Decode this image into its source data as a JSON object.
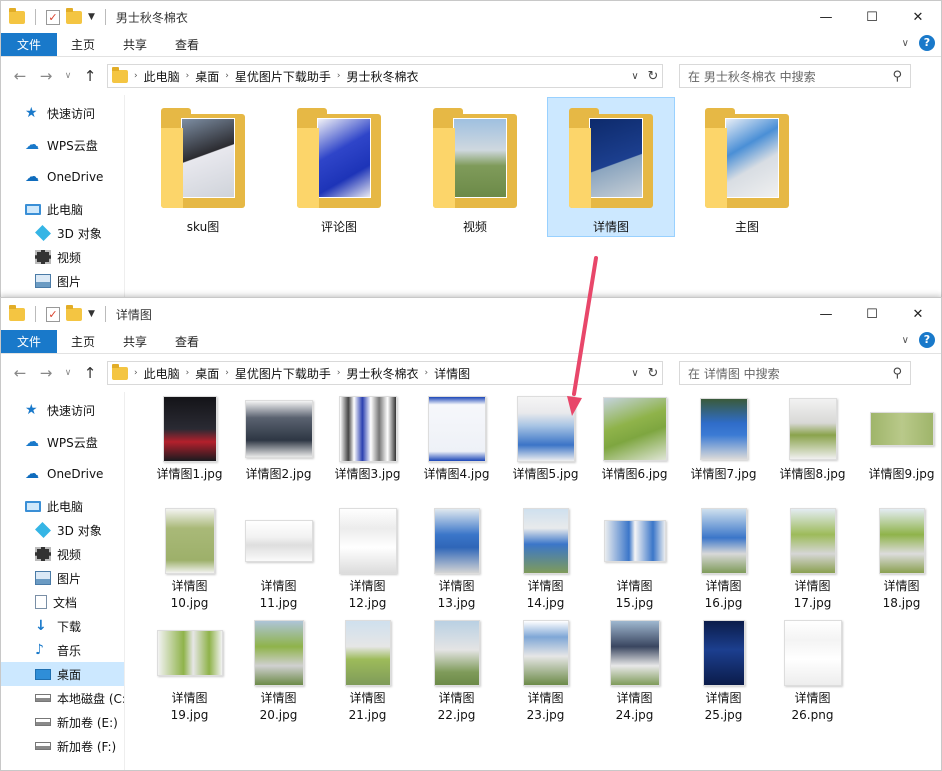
{
  "window1": {
    "title": "男士秋冬棉衣",
    "ribbon_tabs": [
      "文件",
      "主页",
      "共享",
      "查看"
    ],
    "breadcrumb": [
      "此电脑",
      "桌面",
      "星优图片下载助手",
      "男士秋冬棉衣"
    ],
    "search_placeholder": "在 男士秋冬棉衣 中搜索",
    "nav": [
      "快速访问",
      "WPS云盘",
      "OneDrive",
      "此电脑",
      "3D 对象",
      "视频",
      "图片"
    ],
    "folders": [
      "sku图",
      "评论图",
      "视频",
      "详情图",
      "主图"
    ],
    "selected_folder": "详情图"
  },
  "window2": {
    "title": "详情图",
    "ribbon_tabs": [
      "文件",
      "主页",
      "共享",
      "查看"
    ],
    "breadcrumb": [
      "此电脑",
      "桌面",
      "星优图片下载助手",
      "男士秋冬棉衣",
      "详情图"
    ],
    "search_placeholder": "在 详情图 中搜索",
    "nav": [
      "快速访问",
      "WPS云盘",
      "OneDrive",
      "此电脑",
      "3D 对象",
      "视频",
      "图片",
      "文档",
      "下载",
      "音乐",
      "桌面",
      "本地磁盘 (C:",
      "新加卷 (E:)",
      "新加卷 (F:)"
    ],
    "selected_nav": "桌面",
    "files": [
      "详情图1.jpg",
      "详情图2.jpg",
      "详情图3.jpg",
      "详情图4.jpg",
      "详情图5.jpg",
      "详情图6.jpg",
      "详情图7.jpg",
      "详情图8.jpg",
      "详情图9.jpg",
      "详情图\n10.jpg",
      "详情图\n11.jpg",
      "详情图\n12.jpg",
      "详情图\n13.jpg",
      "详情图\n14.jpg",
      "详情图\n15.jpg",
      "详情图\n16.jpg",
      "详情图\n17.jpg",
      "详情图\n18.jpg",
      "详情图\n19.jpg",
      "详情图\n20.jpg",
      "详情图\n21.jpg",
      "详情图\n22.jpg",
      "详情图\n23.jpg",
      "详情图\n24.jpg",
      "详情图\n25.jpg",
      "详情图\n26.png"
    ]
  },
  "colors": {
    "accent": "#1979ca",
    "selection": "#cce8ff",
    "folder": "#f4c542",
    "arrow": "#e8476a"
  }
}
